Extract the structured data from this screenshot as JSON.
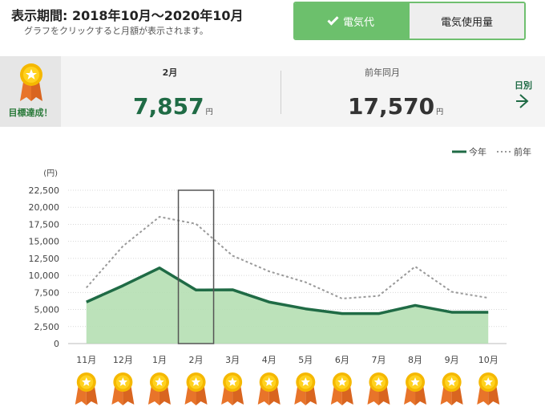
{
  "header": {
    "period_title": "表示期間: 2018年10月〜2020年10月",
    "subtitle": "グラフをクリックすると月額が表示されます。"
  },
  "toggle": {
    "options": [
      {
        "label": "電気代",
        "active": true
      },
      {
        "label": "電気使用量",
        "active": false
      }
    ]
  },
  "summary": {
    "achievement_label": "目標達成！",
    "current_month": "2月",
    "current_value": "7,857",
    "current_unit": "円",
    "prev_label": "前年同月",
    "prev_value": "17,570",
    "prev_unit": "円",
    "daily_link": "日別"
  },
  "colors": {
    "accent": "#6cc06c",
    "this_year_line": "#1f6b45",
    "this_year_fill": "#b5dfb3",
    "last_year_line": "#999999",
    "medal_gold": "#f5b800",
    "medal_ribbon": "#e8742a"
  },
  "chart_data": {
    "type": "area",
    "categories": [
      "11月",
      "12月",
      "1月",
      "2月",
      "3月",
      "4月",
      "5月",
      "6月",
      "7月",
      "8月",
      "9月",
      "10月"
    ],
    "y_unit_label": "(円)",
    "ylim": [
      0,
      22500
    ],
    "yticks": [
      0,
      2500,
      5000,
      7500,
      10000,
      12500,
      15000,
      17500,
      20000,
      22500
    ],
    "ytick_labels": [
      "0",
      "2,500",
      "5,000",
      "7,500",
      "10,000",
      "12,500",
      "15,000",
      "17,500",
      "20,000",
      "22,500"
    ],
    "grid": true,
    "legend_position": "top-right",
    "selected_category": "2月",
    "series": [
      {
        "name": "今年",
        "style": "solid",
        "values": [
          6100,
          8500,
          11100,
          7857,
          7900,
          6100,
          5100,
          4400,
          4400,
          5600,
          4600,
          4600
        ]
      },
      {
        "name": "前年",
        "style": "dotted",
        "values": [
          8200,
          14300,
          18600,
          17570,
          12900,
          10600,
          9000,
          6600,
          7000,
          11300,
          7600,
          6700
        ]
      }
    ],
    "achievements": [
      true,
      true,
      true,
      true,
      true,
      true,
      true,
      true,
      true,
      true,
      true,
      true
    ]
  }
}
